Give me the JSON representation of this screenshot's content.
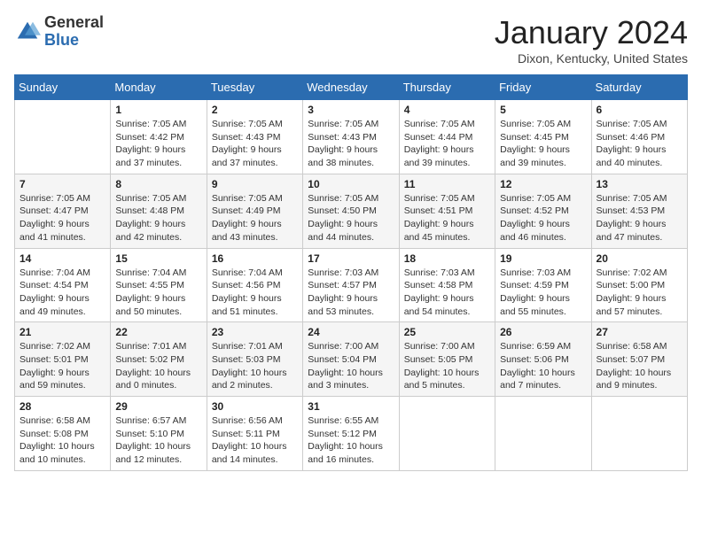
{
  "header": {
    "logo_general": "General",
    "logo_blue": "Blue",
    "title": "January 2024",
    "location": "Dixon, Kentucky, United States"
  },
  "days_of_week": [
    "Sunday",
    "Monday",
    "Tuesday",
    "Wednesday",
    "Thursday",
    "Friday",
    "Saturday"
  ],
  "weeks": [
    [
      {
        "day": "",
        "info": ""
      },
      {
        "day": "1",
        "info": "Sunrise: 7:05 AM\nSunset: 4:42 PM\nDaylight: 9 hours\nand 37 minutes."
      },
      {
        "day": "2",
        "info": "Sunrise: 7:05 AM\nSunset: 4:43 PM\nDaylight: 9 hours\nand 37 minutes."
      },
      {
        "day": "3",
        "info": "Sunrise: 7:05 AM\nSunset: 4:43 PM\nDaylight: 9 hours\nand 38 minutes."
      },
      {
        "day": "4",
        "info": "Sunrise: 7:05 AM\nSunset: 4:44 PM\nDaylight: 9 hours\nand 39 minutes."
      },
      {
        "day": "5",
        "info": "Sunrise: 7:05 AM\nSunset: 4:45 PM\nDaylight: 9 hours\nand 39 minutes."
      },
      {
        "day": "6",
        "info": "Sunrise: 7:05 AM\nSunset: 4:46 PM\nDaylight: 9 hours\nand 40 minutes."
      }
    ],
    [
      {
        "day": "7",
        "info": "Sunrise: 7:05 AM\nSunset: 4:47 PM\nDaylight: 9 hours\nand 41 minutes."
      },
      {
        "day": "8",
        "info": "Sunrise: 7:05 AM\nSunset: 4:48 PM\nDaylight: 9 hours\nand 42 minutes."
      },
      {
        "day": "9",
        "info": "Sunrise: 7:05 AM\nSunset: 4:49 PM\nDaylight: 9 hours\nand 43 minutes."
      },
      {
        "day": "10",
        "info": "Sunrise: 7:05 AM\nSunset: 4:50 PM\nDaylight: 9 hours\nand 44 minutes."
      },
      {
        "day": "11",
        "info": "Sunrise: 7:05 AM\nSunset: 4:51 PM\nDaylight: 9 hours\nand 45 minutes."
      },
      {
        "day": "12",
        "info": "Sunrise: 7:05 AM\nSunset: 4:52 PM\nDaylight: 9 hours\nand 46 minutes."
      },
      {
        "day": "13",
        "info": "Sunrise: 7:05 AM\nSunset: 4:53 PM\nDaylight: 9 hours\nand 47 minutes."
      }
    ],
    [
      {
        "day": "14",
        "info": "Sunrise: 7:04 AM\nSunset: 4:54 PM\nDaylight: 9 hours\nand 49 minutes."
      },
      {
        "day": "15",
        "info": "Sunrise: 7:04 AM\nSunset: 4:55 PM\nDaylight: 9 hours\nand 50 minutes."
      },
      {
        "day": "16",
        "info": "Sunrise: 7:04 AM\nSunset: 4:56 PM\nDaylight: 9 hours\nand 51 minutes."
      },
      {
        "day": "17",
        "info": "Sunrise: 7:03 AM\nSunset: 4:57 PM\nDaylight: 9 hours\nand 53 minutes."
      },
      {
        "day": "18",
        "info": "Sunrise: 7:03 AM\nSunset: 4:58 PM\nDaylight: 9 hours\nand 54 minutes."
      },
      {
        "day": "19",
        "info": "Sunrise: 7:03 AM\nSunset: 4:59 PM\nDaylight: 9 hours\nand 55 minutes."
      },
      {
        "day": "20",
        "info": "Sunrise: 7:02 AM\nSunset: 5:00 PM\nDaylight: 9 hours\nand 57 minutes."
      }
    ],
    [
      {
        "day": "21",
        "info": "Sunrise: 7:02 AM\nSunset: 5:01 PM\nDaylight: 9 hours\nand 59 minutes."
      },
      {
        "day": "22",
        "info": "Sunrise: 7:01 AM\nSunset: 5:02 PM\nDaylight: 10 hours\nand 0 minutes."
      },
      {
        "day": "23",
        "info": "Sunrise: 7:01 AM\nSunset: 5:03 PM\nDaylight: 10 hours\nand 2 minutes."
      },
      {
        "day": "24",
        "info": "Sunrise: 7:00 AM\nSunset: 5:04 PM\nDaylight: 10 hours\nand 3 minutes."
      },
      {
        "day": "25",
        "info": "Sunrise: 7:00 AM\nSunset: 5:05 PM\nDaylight: 10 hours\nand 5 minutes."
      },
      {
        "day": "26",
        "info": "Sunrise: 6:59 AM\nSunset: 5:06 PM\nDaylight: 10 hours\nand 7 minutes."
      },
      {
        "day": "27",
        "info": "Sunrise: 6:58 AM\nSunset: 5:07 PM\nDaylight: 10 hours\nand 9 minutes."
      }
    ],
    [
      {
        "day": "28",
        "info": "Sunrise: 6:58 AM\nSunset: 5:08 PM\nDaylight: 10 hours\nand 10 minutes."
      },
      {
        "day": "29",
        "info": "Sunrise: 6:57 AM\nSunset: 5:10 PM\nDaylight: 10 hours\nand 12 minutes."
      },
      {
        "day": "30",
        "info": "Sunrise: 6:56 AM\nSunset: 5:11 PM\nDaylight: 10 hours\nand 14 minutes."
      },
      {
        "day": "31",
        "info": "Sunrise: 6:55 AM\nSunset: 5:12 PM\nDaylight: 10 hours\nand 16 minutes."
      },
      {
        "day": "",
        "info": ""
      },
      {
        "day": "",
        "info": ""
      },
      {
        "day": "",
        "info": ""
      }
    ]
  ]
}
